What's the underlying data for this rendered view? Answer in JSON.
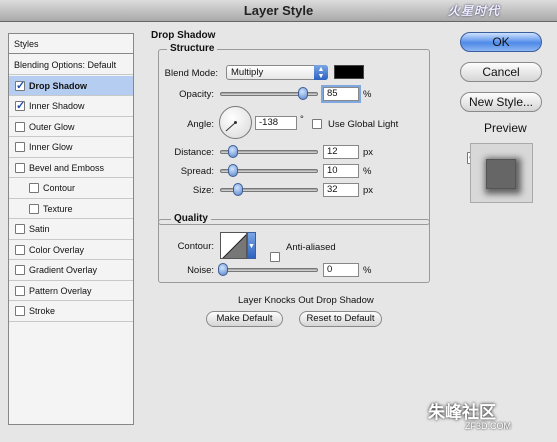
{
  "window": {
    "title": "Layer Style"
  },
  "watermark": {
    "top": "火星时代",
    "bottom": "朱峰社区",
    "url": "ZF3D.COM"
  },
  "sidebar": {
    "header": "Styles",
    "blending_options": "Blending Options: Default",
    "items": [
      {
        "label": "Drop Shadow",
        "checked": true,
        "selected": true
      },
      {
        "label": "Inner Shadow",
        "checked": true,
        "selected": false
      },
      {
        "label": "Outer Glow",
        "checked": false,
        "selected": false
      },
      {
        "label": "Inner Glow",
        "checked": false,
        "selected": false
      },
      {
        "label": "Bevel and Emboss",
        "checked": false,
        "selected": false
      },
      {
        "label": "Contour",
        "checked": false,
        "selected": false
      },
      {
        "label": "Texture",
        "checked": false,
        "selected": false
      },
      {
        "label": "Satin",
        "checked": false,
        "selected": false
      },
      {
        "label": "Color Overlay",
        "checked": false,
        "selected": false
      },
      {
        "label": "Gradient Overlay",
        "checked": false,
        "selected": false
      },
      {
        "label": "Pattern Overlay",
        "checked": false,
        "selected": false
      },
      {
        "label": "Stroke",
        "checked": false,
        "selected": false
      }
    ]
  },
  "drop_shadow": {
    "title": "Drop Shadow",
    "structure": {
      "title": "Structure",
      "blend_mode_label": "Blend Mode:",
      "blend_mode_value": "Multiply",
      "shadow_color": "#000000",
      "opacity_label": "Opacity:",
      "opacity_value": "85",
      "opacity_unit": "%",
      "opacity_level": 0.85,
      "angle_label": "Angle:",
      "angle_value": "-138",
      "angle_unit": "°",
      "use_global_light_label": "Use Global Light",
      "use_global_light": false,
      "distance_label": "Distance:",
      "distance_value": "12",
      "distance_unit": "px",
      "spread_label": "Spread:",
      "spread_value": "10",
      "spread_unit": "%",
      "size_label": "Size:",
      "size_value": "32",
      "size_unit": "px"
    },
    "quality": {
      "title": "Quality",
      "contour_label": "Contour:",
      "anti_aliased_label": "Anti-aliased",
      "anti_aliased": false,
      "noise_label": "Noise:",
      "noise_value": "0",
      "noise_unit": "%"
    },
    "knocks_out_label": "Layer Knocks Out Drop Shadow",
    "knocks_out": true,
    "make_default_label": "Make Default",
    "reset_default_label": "Reset to Default"
  },
  "buttons": {
    "ok": "OK",
    "cancel": "Cancel",
    "new_style": "New Style...",
    "preview_label": "Preview",
    "preview_checked": true
  },
  "colors": {
    "selection": "#b5cdf0",
    "accent": "#4f8ae8"
  }
}
